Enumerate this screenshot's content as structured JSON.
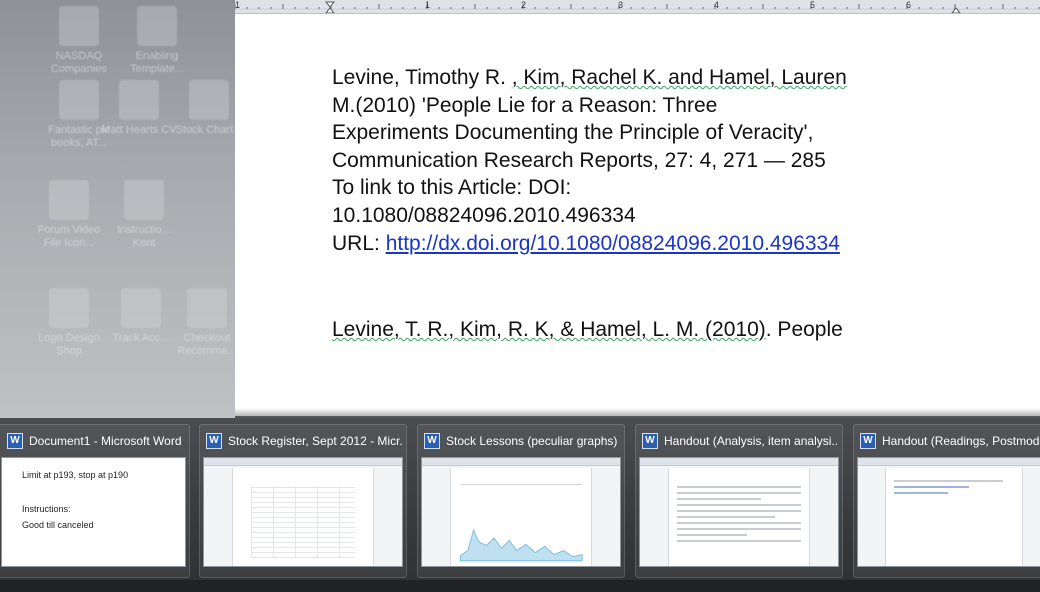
{
  "desktop": {
    "icons": [
      {
        "label": "NASDAQ Companies"
      },
      {
        "label": "Enabling Template..."
      },
      {
        "label": "Fantastic pic books, AT..."
      },
      {
        "label": "Matt Hearts CV"
      },
      {
        "label": "Stock Chart..."
      },
      {
        "label": "Forum Video File Icon..."
      },
      {
        "label": "Instructio... Kent"
      },
      {
        "label": "Logo Design Shop"
      },
      {
        "label": "Track Acc..."
      },
      {
        "label": "Checkout Recomme..."
      }
    ]
  },
  "ruler": {
    "numbers": [
      "1",
      "1",
      "2",
      "3",
      "4",
      "5",
      "6"
    ]
  },
  "document": {
    "citation_apa_1": {
      "line1_part1": "Levine, Timothy R. ",
      "line1_part2": ", Kim, Rachel K. and Hamel, Lauren",
      "line2": "M.(2010) 'People Lie for a Reason: Three",
      "line3": "Experiments Documenting the Principle of Veracity',",
      "line4": "Communication Research Reports, 27: 4, 271 — 285",
      "line5": "To link to this Article: DOI:",
      "line6": "10.1080/08824096.2010.496334",
      "url_label": "URL: ",
      "url": "http://dx.doi.org/10.1080/08824096.2010.496334"
    },
    "citation_apa_2": {
      "squiggled": "Levine, T. R., Kim, R. K, & Hamel, L. M. (2010)",
      "rest": ". People"
    }
  },
  "taskbar_thumbnails": [
    {
      "title": "Document1 - Microsoft Word n...",
      "icon": "word-icon",
      "lines": [
        "Limit at p193, stop at p190",
        "Instructions:",
        "Good till canceled"
      ]
    },
    {
      "title": "Stock Register, Sept 2012 - Micr...",
      "icon": "word-icon"
    },
    {
      "title": "Stock Lessons (peculiar graphs) ...",
      "icon": "word-icon"
    },
    {
      "title": "Handout (Analysis, item analysi...",
      "icon": "word-icon"
    },
    {
      "title": "Handout (Readings, Postmode...",
      "icon": "word-icon"
    }
  ],
  "colors": {
    "link": "#1a35c9",
    "spellcheck": "#3aa35a",
    "word_blue": "#2b5fb4"
  }
}
